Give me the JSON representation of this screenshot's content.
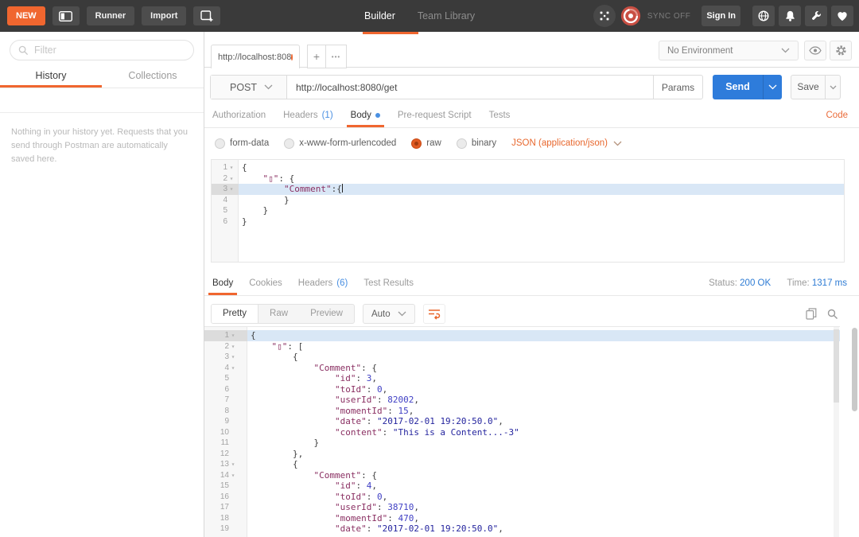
{
  "topbar": {
    "new_label": "NEW",
    "runner_label": "Runner",
    "import_label": "Import",
    "builder_tab": "Builder",
    "team_library_tab": "Team Library",
    "sync_label": "SYNC OFF",
    "sign_in_label": "Sign In"
  },
  "sidebar": {
    "filter_placeholder": "Filter",
    "history_tab": "History",
    "collections_tab": "Collections",
    "empty_message": "Nothing in your history yet. Requests that you send through Postman are automatically saved here."
  },
  "request": {
    "tab_title": "http://localhost:808",
    "new_tab_label": "+",
    "more_tabs_label": "•••",
    "environment": "No Environment",
    "method": "POST",
    "url": "http://localhost:8080/get",
    "params_label": "Params",
    "send_label": "Send",
    "save_label": "Save",
    "tabs": [
      {
        "label": "Authorization"
      },
      {
        "label": "Headers",
        "count": "(1)"
      },
      {
        "label": "Body",
        "active": true,
        "dot": true
      },
      {
        "label": "Pre-request Script"
      },
      {
        "label": "Tests"
      }
    ],
    "code_link": "Code",
    "body_modes": [
      {
        "label": "form-data"
      },
      {
        "label": "x-www-form-urlencoded"
      },
      {
        "label": "raw",
        "selected": true
      },
      {
        "label": "binary"
      }
    ],
    "content_type": "JSON (application/json)",
    "editor": {
      "lines": [
        "{",
        "    \"▯\": {",
        "        \"Comment\":{",
        "        }",
        "    }",
        "}"
      ],
      "highlight_line": 3,
      "cursor_line": 3,
      "fold_lines": [
        1,
        2,
        3
      ]
    }
  },
  "response": {
    "tabs": [
      {
        "label": "Body",
        "active": true
      },
      {
        "label": "Cookies"
      },
      {
        "label": "Headers",
        "count": "(6)"
      },
      {
        "label": "Test Results"
      }
    ],
    "status_label": "Status:",
    "status_value": "200 OK",
    "time_label": "Time:",
    "time_value": "1317 ms",
    "view_modes": [
      {
        "label": "Pretty",
        "active": true
      },
      {
        "label": "Raw"
      },
      {
        "label": "Preview"
      }
    ],
    "format": "Auto",
    "editor": {
      "lines": [
        "{",
        "    \"▯\": [",
        "        {",
        "            \"Comment\": {",
        "                \"id\": 3,",
        "                \"toId\": 0,",
        "                \"userId\": 82002,",
        "                \"momentId\": 15,",
        "                \"date\": \"2017-02-01 19:20:50.0\",",
        "                \"content\": \"This is a Content...-3\"",
        "            }",
        "        },",
        "        {",
        "            \"Comment\": {",
        "                \"id\": 4,",
        "                \"toId\": 0,",
        "                \"userId\": 38710,",
        "                \"momentId\": 470,",
        "                \"date\": \"2017-02-01 19:20:50.0\","
      ],
      "highlight_line": 1,
      "fold_lines": [
        1,
        2,
        3,
        4,
        13,
        14
      ]
    }
  }
}
